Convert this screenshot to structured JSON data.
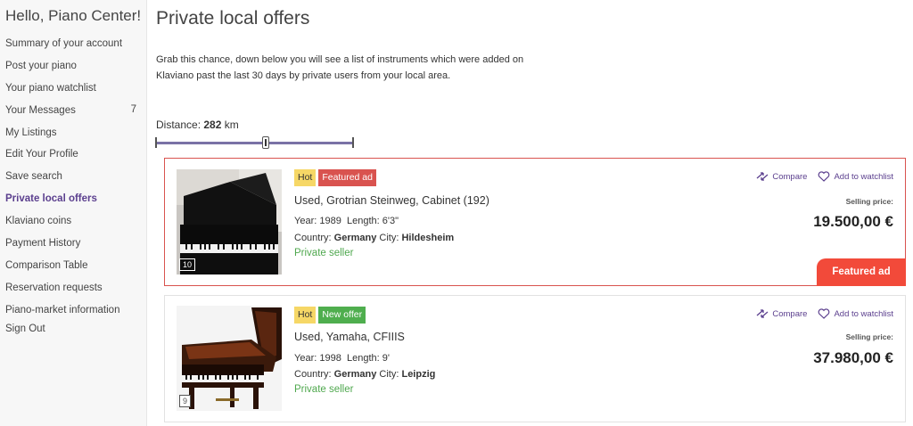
{
  "sidebar": {
    "greeting": "Hello, Piano Center!",
    "items": [
      {
        "label": "Summary of your account"
      },
      {
        "label": "Post your piano"
      },
      {
        "label": "Your piano watchlist"
      },
      {
        "label": "Your Messages",
        "count": "7"
      },
      {
        "label": "My Listings"
      },
      {
        "label": "Edit Your Profile"
      },
      {
        "label": "Save search"
      },
      {
        "label": "Private local offers",
        "active": true
      },
      {
        "label": "Klaviano coins"
      },
      {
        "label": "Payment History"
      },
      {
        "label": "Comparison Table"
      },
      {
        "label": "Reservation requests"
      },
      {
        "label": "Piano-market information"
      },
      {
        "label": "Sign Out"
      }
    ]
  },
  "main": {
    "title": "Private local offers",
    "description": "Grab this chance, down below you will see a list of instruments which were added on Klaviano past the last 30 days by private users from your local area.",
    "distance_label": "Distance:",
    "distance_value": "282",
    "distance_unit": "km",
    "slider_fraction": 0.56
  },
  "listings": [
    {
      "badges": [
        {
          "text": "Hot",
          "type": "hot"
        },
        {
          "text": "Featured ad",
          "type": "featured"
        }
      ],
      "name": "Used, Grotrian Steinweg, Cabinet (192)",
      "year_label": "Year:",
      "year": "1989",
      "length_label": "Length:",
      "length": "6'3\"",
      "country_label": "Country:",
      "country": "Germany",
      "city_label": "City:",
      "city": "Hildesheim",
      "seller": "Private seller",
      "compare": "Compare",
      "watchlist": "Add to watchlist",
      "price_label": "Selling price:",
      "price": "19.500,00 €",
      "photo_count": "10",
      "featured_tab": "Featured ad"
    },
    {
      "badges": [
        {
          "text": "Hot",
          "type": "hot"
        },
        {
          "text": "New offer",
          "type": "new"
        }
      ],
      "name": "Used, Yamaha, CFIIIS",
      "year_label": "Year:",
      "year": "1998",
      "length_label": "Length:",
      "length": "9'",
      "country_label": "Country:",
      "country": "Germany",
      "city_label": "City:",
      "city": "Leipzig",
      "seller": "Private seller",
      "compare": "Compare",
      "watchlist": "Add to watchlist",
      "price_label": "Selling price:",
      "price": "37.980,00 €",
      "photo_count": "9"
    }
  ],
  "colors": {
    "accent": "#5b3f8e",
    "featured": "#d9534f",
    "featured_tab": "#f24a3a",
    "new": "#4fae4e",
    "hot": "#f6d766",
    "seller": "#4fa84e"
  }
}
